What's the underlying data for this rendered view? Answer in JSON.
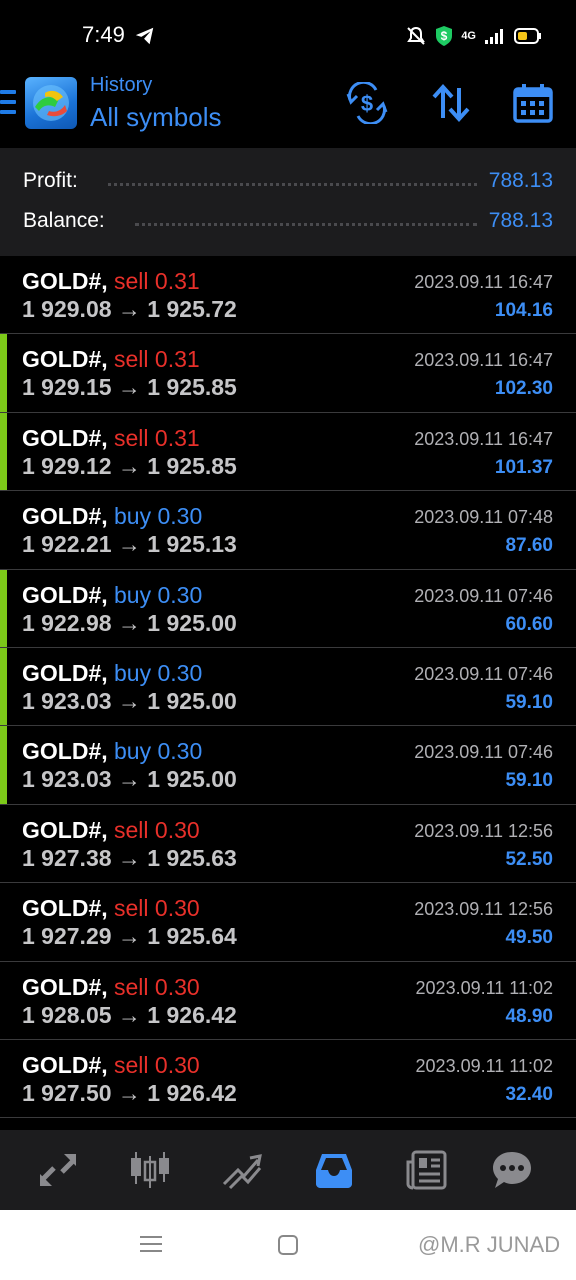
{
  "status_bar": {
    "time": "7:49",
    "network": "4G"
  },
  "header": {
    "title": "History",
    "subtitle": "All symbols",
    "accent_color": "#3d8ef5"
  },
  "summary": {
    "profit_label": "Profit:",
    "profit_value": "788.13",
    "balance_label": "Balance:",
    "balance_value": "788.13"
  },
  "trades": [
    {
      "symbol": "GOLD#,",
      "type": "sell",
      "lots": "0.31",
      "open": "1 929.08",
      "close": "1 925.72",
      "time": "2023.09.11 16:47",
      "profit": "104.16",
      "marked": false
    },
    {
      "symbol": "GOLD#,",
      "type": "sell",
      "lots": "0.31",
      "open": "1 929.15",
      "close": "1 925.85",
      "time": "2023.09.11 16:47",
      "profit": "102.30",
      "marked": true
    },
    {
      "symbol": "GOLD#,",
      "type": "sell",
      "lots": "0.31",
      "open": "1 929.12",
      "close": "1 925.85",
      "time": "2023.09.11 16:47",
      "profit": "101.37",
      "marked": true
    },
    {
      "symbol": "GOLD#,",
      "type": "buy",
      "lots": "0.30",
      "open": "1 922.21",
      "close": "1 925.13",
      "time": "2023.09.11 07:48",
      "profit": "87.60",
      "marked": false
    },
    {
      "symbol": "GOLD#,",
      "type": "buy",
      "lots": "0.30",
      "open": "1 922.98",
      "close": "1 925.00",
      "time": "2023.09.11 07:46",
      "profit": "60.60",
      "marked": true
    },
    {
      "symbol": "GOLD#,",
      "type": "buy",
      "lots": "0.30",
      "open": "1 923.03",
      "close": "1 925.00",
      "time": "2023.09.11 07:46",
      "profit": "59.10",
      "marked": true
    },
    {
      "symbol": "GOLD#,",
      "type": "buy",
      "lots": "0.30",
      "open": "1 923.03",
      "close": "1 925.00",
      "time": "2023.09.11 07:46",
      "profit": "59.10",
      "marked": true
    },
    {
      "symbol": "GOLD#,",
      "type": "sell",
      "lots": "0.30",
      "open": "1 927.38",
      "close": "1 925.63",
      "time": "2023.09.11 12:56",
      "profit": "52.50",
      "marked": false
    },
    {
      "symbol": "GOLD#,",
      "type": "sell",
      "lots": "0.30",
      "open": "1 927.29",
      "close": "1 925.64",
      "time": "2023.09.11 12:56",
      "profit": "49.50",
      "marked": false
    },
    {
      "symbol": "GOLD#,",
      "type": "sell",
      "lots": "0.30",
      "open": "1 928.05",
      "close": "1 926.42",
      "time": "2023.09.11 11:02",
      "profit": "48.90",
      "marked": false
    },
    {
      "symbol": "GOLD#,",
      "type": "sell",
      "lots": "0.30",
      "open": "1 927.50",
      "close": "1 926.42",
      "time": "2023.09.11 11:02",
      "profit": "32.40",
      "marked": false
    }
  ],
  "arrow": "→",
  "bottom_nav": {
    "items": [
      "trade-icon",
      "chart-candles-icon",
      "quotes-trend-icon",
      "history-inbox-icon",
      "news-icon",
      "chat-icon"
    ],
    "active": "history-inbox-icon"
  },
  "watermark": "@M.R JUNAD"
}
